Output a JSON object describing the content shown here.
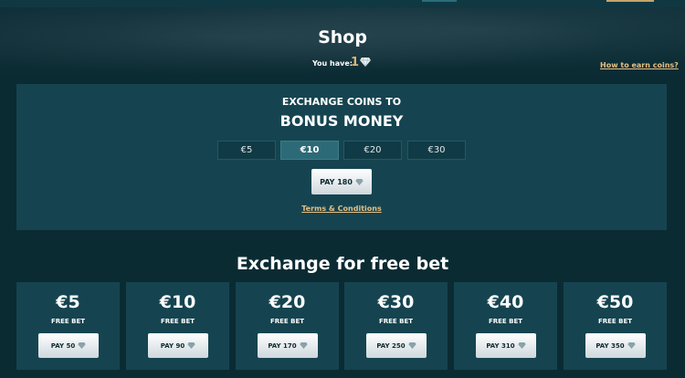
{
  "header": {
    "title": "Shop",
    "you_have_label": "You have:",
    "coin_count": "1",
    "how_to_earn": "How to earn coins?"
  },
  "exchange": {
    "label": "EXCHANGE COINS TO",
    "title": "BONUS MONEY",
    "amounts": [
      "€5",
      "€10",
      "€20",
      "€30"
    ],
    "selected_amount": "€10",
    "pay_label": "PAY 180",
    "terms": "Terms & Conditions"
  },
  "freebet": {
    "title": "Exchange for free bet",
    "cards": [
      {
        "amount": "€5",
        "sub": "FREE BET",
        "pay": "PAY 50"
      },
      {
        "amount": "€10",
        "sub": "FREE BET",
        "pay": "PAY 90"
      },
      {
        "amount": "€20",
        "sub": "FREE BET",
        "pay": "PAY 170"
      },
      {
        "amount": "€30",
        "sub": "FREE BET",
        "pay": "PAY 250"
      },
      {
        "amount": "€40",
        "sub": "FREE BET",
        "pay": "PAY 310"
      },
      {
        "amount": "€50",
        "sub": "FREE BET",
        "pay": "PAY 350"
      }
    ]
  },
  "icons": {
    "coin": "diamond-icon"
  },
  "colors": {
    "accent": "#e6bf82",
    "panel": "#154450",
    "background": "#0b2b33",
    "selected": "#2d6a77"
  }
}
